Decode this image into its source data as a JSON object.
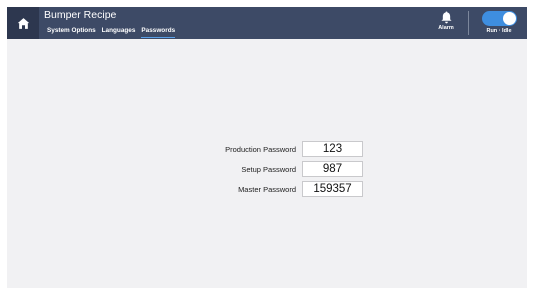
{
  "header": {
    "title": "Bumper Recipe",
    "tabs": [
      {
        "label": "System Options"
      },
      {
        "label": "Languages"
      },
      {
        "label": "Passwords",
        "active": true
      }
    ],
    "alarm_label": "Alarm",
    "toggle_label": "Run · Idle",
    "toggle_on": true
  },
  "passwords": [
    {
      "label": "Production Password",
      "value": "123"
    },
    {
      "label": "Setup Password",
      "value": "987"
    },
    {
      "label": "Master Password",
      "value": "159357"
    }
  ],
  "colors": {
    "header_bg": "#3d4a66",
    "home_bg": "#2d374f",
    "accent": "#3e8ee0",
    "page_bg": "#f1f1f3"
  },
  "icons": {
    "home": "home-icon",
    "alarm": "bell-icon"
  }
}
